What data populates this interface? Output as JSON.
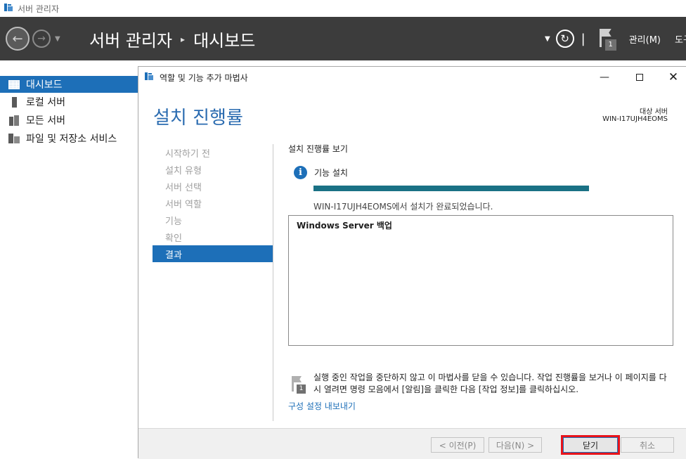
{
  "app": {
    "title": "서버 관리자"
  },
  "header": {
    "breadcrumb_root": "서버 관리자",
    "breadcrumb_sep": "▸",
    "breadcrumb_page": "대시보드",
    "notification_count": "1",
    "menu_manage": "관리(M)",
    "menu_tools": "도구"
  },
  "sidebar": {
    "items": [
      {
        "label": "대시보드",
        "icon": "dashboard-grid-icon",
        "active": true
      },
      {
        "label": "로컬 서버",
        "icon": "server-icon",
        "active": false
      },
      {
        "label": "모든 서버",
        "icon": "servers-icon",
        "active": false
      },
      {
        "label": "파일 및 저장소 서비스",
        "icon": "storage-icon",
        "active": false
      }
    ]
  },
  "wizard": {
    "title": "역할 및 기능 추가 마법사",
    "page_title": "설치 진행률",
    "target_label": "대상 서버",
    "target_value": "WIN-I17UJH4EOMS",
    "steps": [
      {
        "label": "시작하기 전",
        "active": false
      },
      {
        "label": "설치 유형",
        "active": false
      },
      {
        "label": "서버 선택",
        "active": false
      },
      {
        "label": "서버 역할",
        "active": false
      },
      {
        "label": "기능",
        "active": false
      },
      {
        "label": "확인",
        "active": false
      },
      {
        "label": "결과",
        "active": true
      }
    ],
    "view_progress_label": "설치 진행률 보기",
    "info_text": "기능 설치",
    "progress_fraction": 1.0,
    "done_message": "WIN-I17UJH4EOMS에서 설치가 완료되었습니다.",
    "results": [
      "Windows Server 백업"
    ],
    "note": "실행 중인 작업을 중단하지 않고 이 마법사를 닫을 수 있습니다. 작업 진행률을 보거나 이 페이지를 다시 열려면 명령 모음에서 [알림]을 클릭한 다음 [작업 정보]를 클릭하십시오.",
    "note_badge": "1",
    "export_link": "구성 설정 내보내기",
    "buttons": {
      "prev": "< 이전(P)",
      "next": "다음(N) >",
      "close": "닫기",
      "cancel": "취소"
    }
  },
  "colors": {
    "accent": "#1d6fb8",
    "header_bg": "#3c3c3c",
    "progress": "#1a7185",
    "highlight": "#e8141b"
  }
}
